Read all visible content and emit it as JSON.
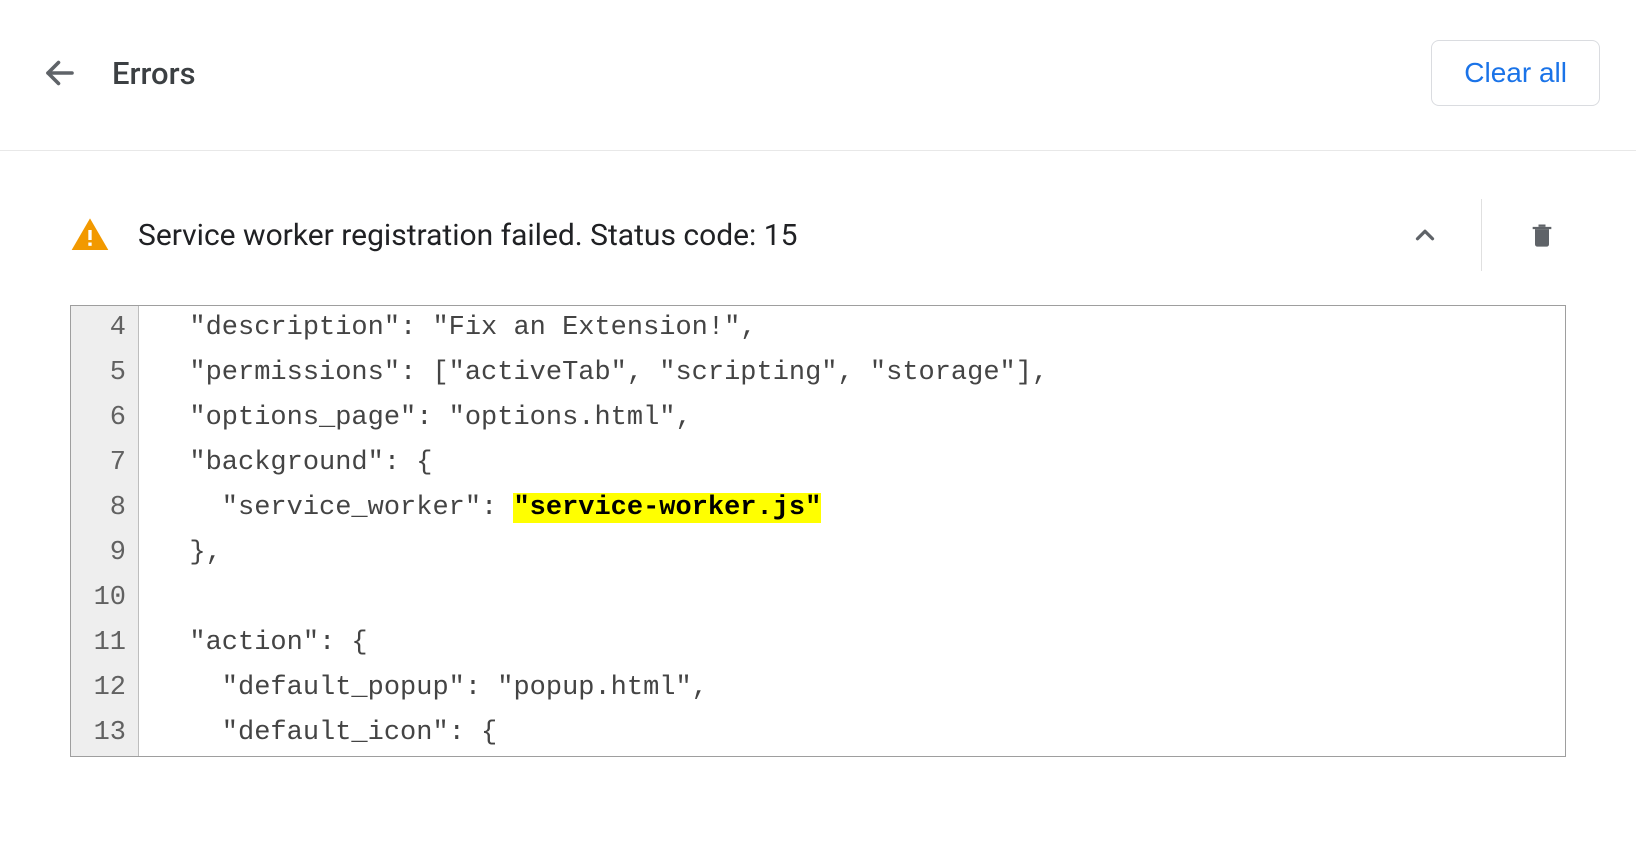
{
  "header": {
    "title": "Errors",
    "clear_all_label": "Clear all"
  },
  "error": {
    "message": "Service worker registration failed. Status code: 15",
    "code_lines": [
      {
        "n": 4,
        "segments": [
          {
            "t": "  \"description\": \"Fix an Extension!\","
          }
        ]
      },
      {
        "n": 5,
        "segments": [
          {
            "t": "  \"permissions\": [\"activeTab\", \"scripting\", \"storage\"],"
          }
        ]
      },
      {
        "n": 6,
        "segments": [
          {
            "t": "  \"options_page\": \"options.html\","
          }
        ]
      },
      {
        "n": 7,
        "segments": [
          {
            "t": "  \"background\": {"
          }
        ]
      },
      {
        "n": 8,
        "segments": [
          {
            "t": "    \"service_worker\": "
          },
          {
            "t": "\"service-worker.js\"",
            "hl": true
          }
        ]
      },
      {
        "n": 9,
        "segments": [
          {
            "t": "  },"
          }
        ]
      },
      {
        "n": 10,
        "segments": [
          {
            "t": ""
          }
        ]
      },
      {
        "n": 11,
        "segments": [
          {
            "t": "  \"action\": {"
          }
        ]
      },
      {
        "n": 12,
        "segments": [
          {
            "t": "    \"default_popup\": \"popup.html\","
          }
        ]
      },
      {
        "n": 13,
        "segments": [
          {
            "t": "    \"default_icon\": {"
          }
        ]
      }
    ]
  },
  "colors": {
    "accent": "#1a73e8",
    "warning": "#f29900",
    "highlight": "#ffff00"
  }
}
